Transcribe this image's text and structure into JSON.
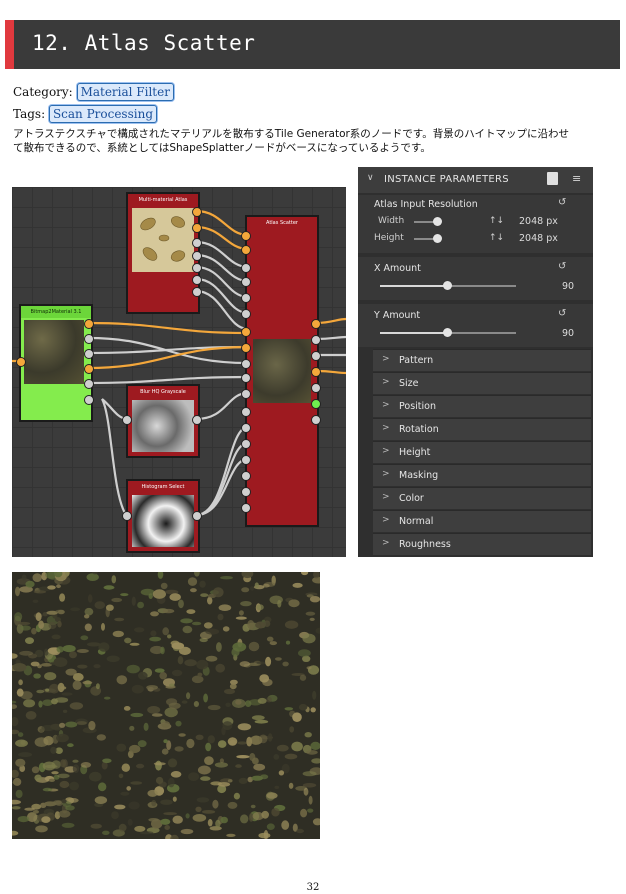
{
  "heading": {
    "number": "12.",
    "title": "Atlas Scatter"
  },
  "meta": {
    "category_label": "Category:",
    "category_tag": "Material Filter",
    "tags_label": "Tags:",
    "tags_tag": "Scan Processing"
  },
  "description": "アトラステクスチャで構成されたマテリアルを散布するTile Generator系のノードです。背景のハイトマップに沿わせて散布できるので、系統としてはShapeSplatterノードがベースになっているようです。",
  "graph": {
    "nodes": [
      "Multi-material Atlas",
      "Bitmap2Material 3.1",
      "Blur HQ Grayscale",
      "Histogram Select",
      "Atlas Scatter"
    ]
  },
  "panel": {
    "header": "INSTANCE PARAMETERS",
    "icons": [
      "preset-icon",
      "export-icon"
    ],
    "atlas_resolution": {
      "label": "Atlas Input Resolution",
      "width_label": "Width",
      "height_label": "Height",
      "width_value": "2048 px",
      "height_value": "2048 px",
      "width_level": 0.45,
      "height_level": 0.45
    },
    "x_amount": {
      "label": "X Amount",
      "value": "90",
      "level": 0.5
    },
    "y_amount": {
      "label": "Y Amount",
      "value": "90",
      "level": 0.5
    },
    "groups": [
      "Pattern",
      "Size",
      "Position",
      "Rotation",
      "Height",
      "Masking",
      "Color",
      "Normal",
      "Roughness"
    ]
  },
  "page_number": "32"
}
